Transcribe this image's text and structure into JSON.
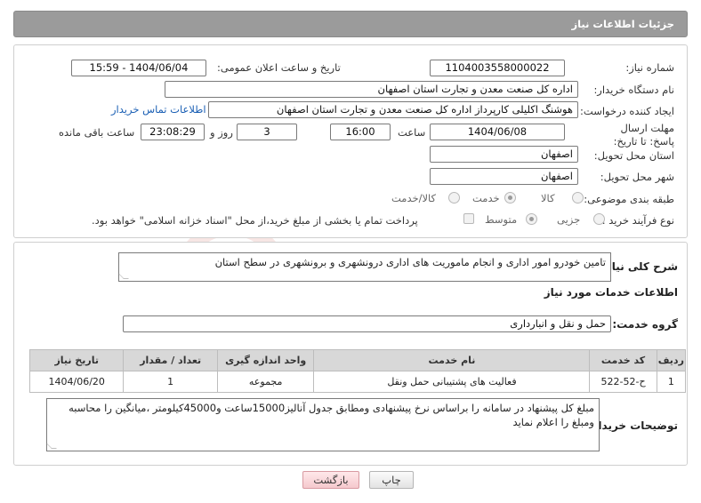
{
  "header": {
    "title": "جزئیات اطلاعات نیاز"
  },
  "need_number": {
    "label": "شماره نیاز:",
    "value": "1104003558000022"
  },
  "announce_datetime": {
    "label": "تاریخ و ساعت اعلان عمومی:",
    "value": "1404/06/04 - 15:59"
  },
  "buyer_org": {
    "label": "نام دستگاه خریدار:",
    "value": "اداره کل صنعت  معدن و تجارت استان اصفهان"
  },
  "requester": {
    "label": "ایجاد کننده درخواست:",
    "value": "هوشنگ  اکلیلی کارپرداز اداره کل صنعت  معدن و تجارت استان اصفهان",
    "contact_link": "اطلاعات تماس خریدار"
  },
  "deadline": {
    "label": "مهلت ارسال پاسخ: تا تاریخ:",
    "date": "1404/06/08",
    "time_label": "ساعت",
    "time": "16:00",
    "days": "3",
    "days_label": "روز و",
    "remaining": "23:08:29",
    "remaining_label": "ساعت باقی مانده"
  },
  "delivery_province": {
    "label": "استان محل تحویل:",
    "value": "اصفهان"
  },
  "delivery_city": {
    "label": "شهر محل تحویل:",
    "value": "اصفهان"
  },
  "category": {
    "label": "طبقه بندی موضوعی:",
    "options": [
      "کالا",
      "خدمت",
      "کالا/خدمت"
    ],
    "selected": "خدمت"
  },
  "purchase_type": {
    "label": "نوع فرآیند خرید :",
    "options": [
      "جزیی",
      "متوسط"
    ],
    "selected": "متوسط",
    "payment_note": "پرداخت تمام یا بخشی از مبلغ خرید،از محل \"اسناد خزانه اسلامی\" خواهد بود."
  },
  "summary": {
    "label": "شرح کلی نیاز:",
    "value": "تامین خودرو امور اداری و انجام ماموریت های اداری درونشهری و برونشهری  در سطح استان"
  },
  "services_title": "اطلاعات خدمات مورد نیاز",
  "service_group": {
    "label": "گروه خدمت:",
    "value": "حمل و نقل و انبارداری"
  },
  "table": {
    "headers": [
      "ردیف",
      "کد خدمت",
      "نام خدمت",
      "واحد اندازه گیری",
      "تعداد / مقدار",
      "تاریخ نیاز"
    ],
    "rows": [
      [
        "1",
        "ح-52-522",
        "فعالیت های پشتیبانی حمل ونقل",
        "مجموعه",
        "1",
        "1404/06/20"
      ]
    ]
  },
  "buyer_notes": {
    "label": "توضیحات خریدار:",
    "value": "مبلغ کل پیشنهاد  در سامانه را براساس نرخ پیشنهادی ومطابق جدول آنالیز15000ساعت و45000کیلومتر ،میانگین را محاسبه ومبلغ را اعلام نماید"
  },
  "buttons": {
    "print": "چاپ",
    "back": "بازگشت"
  },
  "watermark": "AriaTender.net",
  "colors": {
    "header_bg": "#9b9b9b",
    "link": "#1a5fb4",
    "back_button": "#f5c9cd"
  }
}
